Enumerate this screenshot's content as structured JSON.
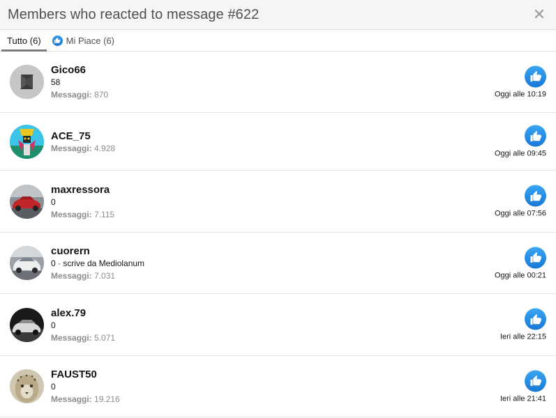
{
  "header": {
    "title": "Members who reacted to message #622",
    "close_label": "✕"
  },
  "tabs": [
    {
      "label": "Tutto (6)",
      "active": true,
      "icon": null
    },
    {
      "label": "Mi Piace (6)",
      "active": false,
      "icon": "like-icon"
    }
  ],
  "colors": {
    "like_blue": "#2a8fe6",
    "header_bg": "#f5f5f5",
    "muted": "#8c8c8c"
  },
  "members": [
    {
      "name": "Gico66",
      "title": "58",
      "stats_label": "Messaggi:",
      "stats_value": "870",
      "time": "Oggi alle 10:19",
      "reaction": "like-icon",
      "avatar": "suzuki-logo-avatar"
    },
    {
      "name": "ACE_75",
      "title": "",
      "stats_label": "Messaggi:",
      "stats_value": "4.928",
      "time": "Oggi alle 09:45",
      "reaction": "like-icon",
      "avatar": "robot-avatar"
    },
    {
      "name": "maxressora",
      "title": "0",
      "stats_label": "Messaggi:",
      "stats_value": "7.115",
      "time": "Oggi alle 07:56",
      "reaction": "like-icon",
      "avatar": "red-car-avatar"
    },
    {
      "name": "cuorern",
      "title": "0 · scrive da Mediolanum",
      "stats_label": "Messaggi:",
      "stats_value": "7.031",
      "time": "Oggi alle 00:21",
      "reaction": "like-icon",
      "avatar": "white-car-avatar"
    },
    {
      "name": "alex.79",
      "title": "0",
      "stats_label": "Messaggi:",
      "stats_value": "5.071",
      "time": "Ieri alle 22:15",
      "reaction": "like-icon",
      "avatar": "black-white-car-avatar"
    },
    {
      "name": "FAUST50",
      "title": "0",
      "stats_label": "Messaggi:",
      "stats_value": "19.216",
      "time": "Ieri alle 21:41",
      "reaction": "like-icon",
      "avatar": "leopard-avatar"
    }
  ]
}
